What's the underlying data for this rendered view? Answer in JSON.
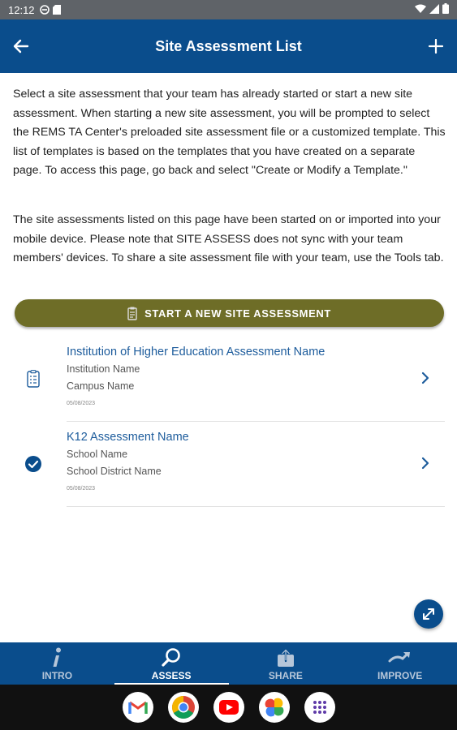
{
  "status_bar": {
    "time": "12:12"
  },
  "header": {
    "title": "Site Assessment List"
  },
  "intro": {
    "paragraph1": "Select a site assessment that your team has already started or start a new site assessment. When starting a new site assessment, you will be prompted to select the REMS TA Center's preloaded site assessment file or a customized template. This list of templates is based on the templates that you have created on a separate page. To access this page, go back and select \"Create or Modify a Template.\"",
    "paragraph2": "The site assessments listed on this page have been started on or imported into your mobile device. Please note that SITE ASSESS does not sync with your team members' devices. To share a site assessment file with your team, use the Tools tab."
  },
  "start_button": {
    "label": "START A NEW SITE ASSESSMENT"
  },
  "assessments": [
    {
      "name": "Institution of Higher Education Assessment Name",
      "line1": "Institution Name",
      "line2": "Campus Name",
      "date": "05/08/2023",
      "icon": "clipboard-icon"
    },
    {
      "name": "K12 Assessment Name",
      "line1": "School Name",
      "line2": "School District Name",
      "date": "05/08/2023",
      "icon": "check-circle-icon"
    }
  ],
  "bottom_nav": [
    {
      "label": "INTRO",
      "icon": "info-icon",
      "active": false
    },
    {
      "label": "ASSESS",
      "icon": "search-icon",
      "active": true
    },
    {
      "label": "SHARE",
      "icon": "share-icon",
      "active": false
    },
    {
      "label": "IMPROVE",
      "icon": "trend-icon",
      "active": false
    }
  ],
  "colors": {
    "primary": "#0a4d8c",
    "accent": "#6e6d27",
    "link": "#1d5c9c"
  },
  "dock_apps": [
    "gmail-icon",
    "chrome-icon",
    "youtube-icon",
    "photos-icon",
    "app-drawer-icon"
  ]
}
